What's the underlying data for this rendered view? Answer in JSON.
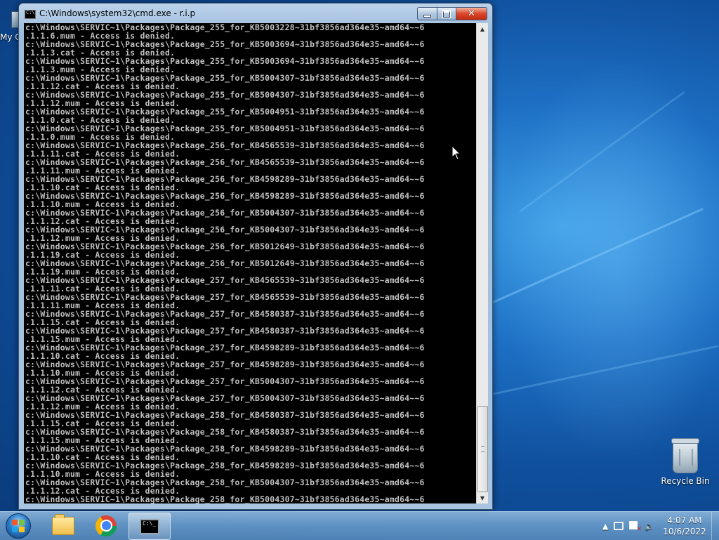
{
  "desktop": {
    "icons": {
      "recycle_bin": "Recycle Bin",
      "my_computer_partial": "My C"
    },
    "wallpaper_colors": [
      "#0f4f9c",
      "#3f9fe6"
    ]
  },
  "window": {
    "title": "C:\\Windows\\system32\\cmd.exe - r.i.p",
    "icon": "cmd-icon",
    "buttons": {
      "minimize": "minimize-icon",
      "maximize": "maximize-icon",
      "close": "close-icon"
    },
    "console_lines": [
      "c:\\Windows\\SERVIC~1\\Packages\\Package_255_for_KB5003228~31bf3856ad364e35~amd64~~6",
      ".1.1.6.mum - Access is denied.",
      "c:\\Windows\\SERVIC~1\\Packages\\Package_255_for_KB5003694~31bf3856ad364e35~amd64~~6",
      ".1.1.3.cat - Access is denied.",
      "c:\\Windows\\SERVIC~1\\Packages\\Package_255_for_KB5003694~31bf3856ad364e35~amd64~~6",
      ".1.1.3.mum - Access is denied.",
      "c:\\Windows\\SERVIC~1\\Packages\\Package_255_for_KB5004307~31bf3856ad364e35~amd64~~6",
      ".1.1.12.cat - Access is denied.",
      "c:\\Windows\\SERVIC~1\\Packages\\Package_255_for_KB5004307~31bf3856ad364e35~amd64~~6",
      ".1.1.12.mum - Access is denied.",
      "c:\\Windows\\SERVIC~1\\Packages\\Package_255_for_KB5004951~31bf3856ad364e35~amd64~~6",
      ".1.1.0.cat - Access is denied.",
      "c:\\Windows\\SERVIC~1\\Packages\\Package_255_for_KB5004951~31bf3856ad364e35~amd64~~6",
      ".1.1.0.mum - Access is denied.",
      "c:\\Windows\\SERVIC~1\\Packages\\Package_256_for_KB4565539~31bf3856ad364e35~amd64~~6",
      ".1.1.11.cat - Access is denied.",
      "c:\\Windows\\SERVIC~1\\Packages\\Package_256_for_KB4565539~31bf3856ad364e35~amd64~~6",
      ".1.1.11.mum - Access is denied.",
      "c:\\Windows\\SERVIC~1\\Packages\\Package_256_for_KB4598289~31bf3856ad364e35~amd64~~6",
      ".1.1.10.cat - Access is denied.",
      "c:\\Windows\\SERVIC~1\\Packages\\Package_256_for_KB4598289~31bf3856ad364e35~amd64~~6",
      ".1.1.10.mum - Access is denied.",
      "c:\\Windows\\SERVIC~1\\Packages\\Package_256_for_KB5004307~31bf3856ad364e35~amd64~~6",
      ".1.1.12.cat - Access is denied.",
      "c:\\Windows\\SERVIC~1\\Packages\\Package_256_for_KB5004307~31bf3856ad364e35~amd64~~6",
      ".1.1.12.mum - Access is denied.",
      "c:\\Windows\\SERVIC~1\\Packages\\Package_256_for_KB5012649~31bf3856ad364e35~amd64~~6",
      ".1.1.19.cat - Access is denied.",
      "c:\\Windows\\SERVIC~1\\Packages\\Package_256_for_KB5012649~31bf3856ad364e35~amd64~~6",
      ".1.1.19.mum - Access is denied.",
      "c:\\Windows\\SERVIC~1\\Packages\\Package_257_for_KB4565539~31bf3856ad364e35~amd64~~6",
      ".1.1.11.cat - Access is denied.",
      "c:\\Windows\\SERVIC~1\\Packages\\Package_257_for_KB4565539~31bf3856ad364e35~amd64~~6",
      ".1.1.11.mum - Access is denied.",
      "c:\\Windows\\SERVIC~1\\Packages\\Package_257_for_KB4580387~31bf3856ad364e35~amd64~~6",
      ".1.1.15.cat - Access is denied.",
      "c:\\Windows\\SERVIC~1\\Packages\\Package_257_for_KB4580387~31bf3856ad364e35~amd64~~6",
      ".1.1.15.mum - Access is denied.",
      "c:\\Windows\\SERVIC~1\\Packages\\Package_257_for_KB4598289~31bf3856ad364e35~amd64~~6",
      ".1.1.10.cat - Access is denied.",
      "c:\\Windows\\SERVIC~1\\Packages\\Package_257_for_KB4598289~31bf3856ad364e35~amd64~~6",
      ".1.1.10.mum - Access is denied.",
      "c:\\Windows\\SERVIC~1\\Packages\\Package_257_for_KB5004307~31bf3856ad364e35~amd64~~6",
      ".1.1.12.cat - Access is denied.",
      "c:\\Windows\\SERVIC~1\\Packages\\Package_257_for_KB5004307~31bf3856ad364e35~amd64~~6",
      ".1.1.12.mum - Access is denied.",
      "c:\\Windows\\SERVIC~1\\Packages\\Package_258_for_KB4580387~31bf3856ad364e35~amd64~~6",
      ".1.1.15.cat - Access is denied.",
      "c:\\Windows\\SERVIC~1\\Packages\\Package_258_for_KB4580387~31bf3856ad364e35~amd64~~6",
      ".1.1.15.mum - Access is denied.",
      "c:\\Windows\\SERVIC~1\\Packages\\Package_258_for_KB4598289~31bf3856ad364e35~amd64~~6",
      ".1.1.10.cat - Access is denied.",
      "c:\\Windows\\SERVIC~1\\Packages\\Package_258_for_KB4598289~31bf3856ad364e35~amd64~~6",
      ".1.1.10.mum - Access is denied.",
      "c:\\Windows\\SERVIC~1\\Packages\\Package_258_for_KB5004307~31bf3856ad364e35~amd64~~6",
      ".1.1.12.cat - Access is denied.",
      "c:\\Windows\\SERVIC~1\\Packages\\Package_258_for_KB5004307~31bf3856ad364e35~amd64~~6"
    ]
  },
  "taskbar": {
    "start": "windows-start-orb-icon",
    "pinned": [
      "explorer-folder-icon",
      "chrome-icon",
      "cmd-icon"
    ],
    "tray": {
      "show_hidden": "▲",
      "icons": [
        "network-icon",
        "action-center-flag-icon",
        "volume-icon"
      ]
    },
    "clock": {
      "time": "4:07 AM",
      "date": "10/6/2022"
    }
  }
}
